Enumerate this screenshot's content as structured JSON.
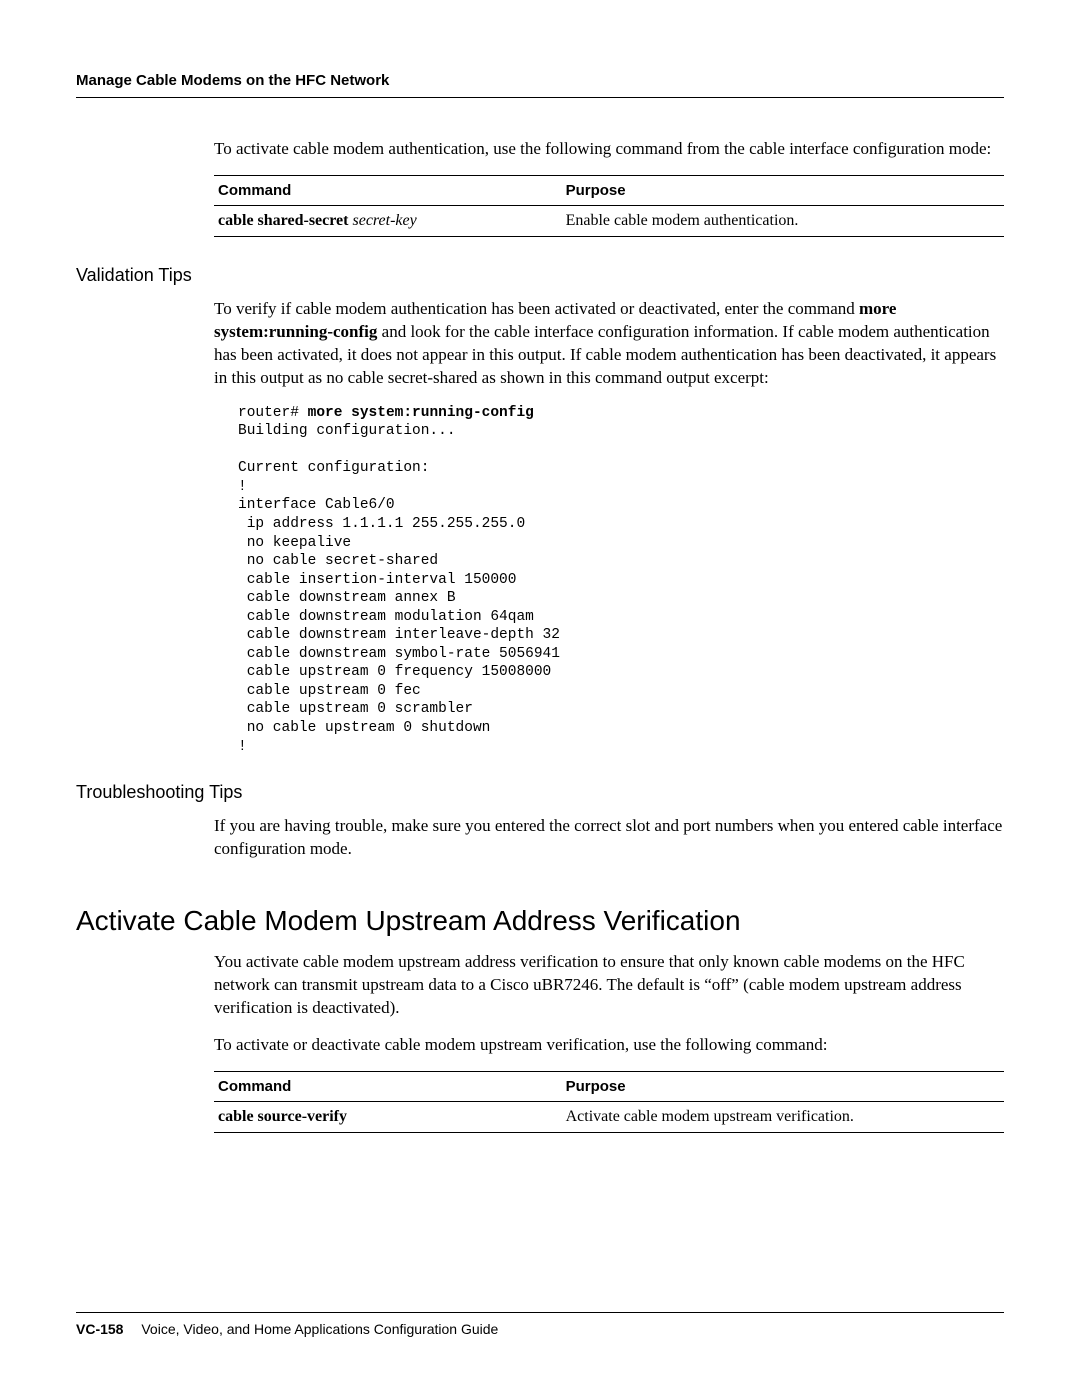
{
  "header": {
    "running_head": "Manage Cable Modems on the HFC Network"
  },
  "intro_para": "To activate cable modem authentication, use the following command from the cable interface configuration mode:",
  "table1": {
    "head_command": "Command",
    "head_purpose": "Purpose",
    "cmd_name": "cable shared-secret",
    "cmd_arg": "secret-key",
    "purpose": "Enable cable modem authentication."
  },
  "validation": {
    "heading": "Validation Tips",
    "para_pre": "To verify if cable modem authentication has been activated or deactivated, enter the command ",
    "para_bold": "more system:running-config",
    "para_post": " and look for the cable interface configuration information. If cable modem authentication has been activated, it does not appear in this output. If cable modem authentication has been deactivated, it appears in this output as no cable secret-shared as shown in this command output excerpt:",
    "code_prompt": "router# ",
    "code_cmd": "more system:running-config",
    "code_body": "Building configuration...\n\nCurrent configuration:\n!\ninterface Cable6/0\n ip address 1.1.1.1 255.255.255.0\n no keepalive\n no cable secret-shared\n cable insertion-interval 150000\n cable downstream annex B\n cable downstream modulation 64qam\n cable downstream interleave-depth 32\n cable downstream symbol-rate 5056941\n cable upstream 0 frequency 15008000\n cable upstream 0 fec\n cable upstream 0 scrambler\n no cable upstream 0 shutdown\n!"
  },
  "troubleshoot": {
    "heading": "Troubleshooting Tips",
    "para": "If you are having trouble, make sure you entered the correct slot and port numbers when you entered cable interface configuration mode."
  },
  "section2": {
    "heading": "Activate Cable Modem Upstream Address Verification",
    "para1": "You activate cable modem upstream address verification to ensure that only known cable modems on the HFC network can transmit upstream data to a Cisco uBR7246. The default is “off” (cable modem upstream address verification is deactivated).",
    "para2": "To activate or deactivate cable modem upstream verification, use the following command:"
  },
  "table2": {
    "head_command": "Command",
    "head_purpose": "Purpose",
    "cmd_name": "cable source-verify",
    "purpose": "Activate cable modem upstream verification."
  },
  "footer": {
    "pageno": "VC-158",
    "title": "Voice, Video, and Home Applications Configuration Guide"
  }
}
